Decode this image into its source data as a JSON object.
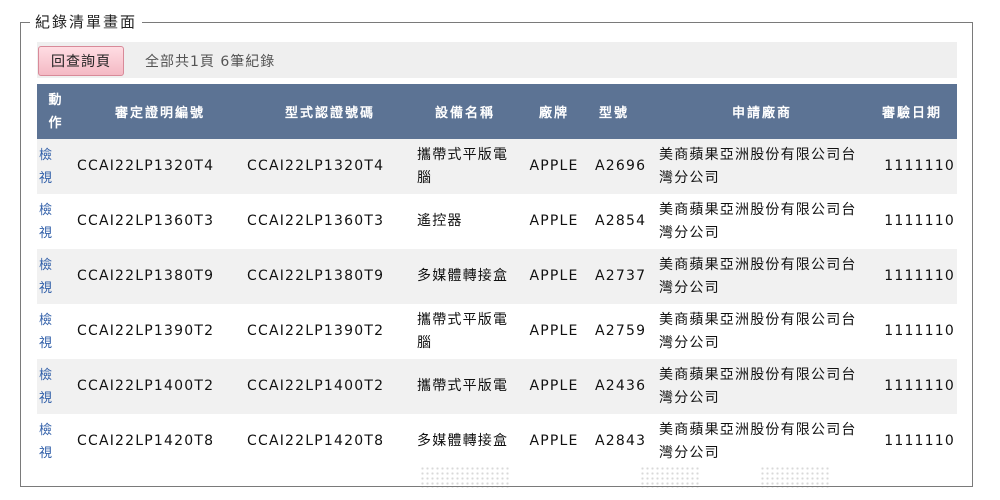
{
  "panel": {
    "title": "紀錄清單畫面"
  },
  "toolbar": {
    "back_label": "回查詢頁",
    "summary": "全部共1頁  6筆紀錄"
  },
  "table": {
    "headers": [
      "動作",
      "審定證明編號",
      "型式認證號碼",
      "設備名稱",
      "廠牌",
      "型號",
      "申請廠商",
      "審驗日期"
    ],
    "rows": [
      {
        "action": "檢視",
        "cert_no": "CCAI22LP1320T4",
        "type_no": "CCAI22LP1320T4",
        "device": "攜帶式平版電腦",
        "brand": "APPLE",
        "model": "A2696",
        "vendor": "美商蘋果亞洲股份有限公司台灣分公司",
        "date": "1111110"
      },
      {
        "action": "檢視",
        "cert_no": "CCAI22LP1360T3",
        "type_no": "CCAI22LP1360T3",
        "device": "遙控器",
        "brand": "APPLE",
        "model": "A2854",
        "vendor": "美商蘋果亞洲股份有限公司台灣分公司",
        "date": "1111110"
      },
      {
        "action": "檢視",
        "cert_no": "CCAI22LP1380T9",
        "type_no": "CCAI22LP1380T9",
        "device": "多媒體轉接盒",
        "brand": "APPLE",
        "model": "A2737",
        "vendor": "美商蘋果亞洲股份有限公司台灣分公司",
        "date": "1111110"
      },
      {
        "action": "檢視",
        "cert_no": "CCAI22LP1390T2",
        "type_no": "CCAI22LP1390T2",
        "device": "攜帶式平版電腦",
        "brand": "APPLE",
        "model": "A2759",
        "vendor": "美商蘋果亞洲股份有限公司台灣分公司",
        "date": "1111110"
      },
      {
        "action": "檢視",
        "cert_no": "CCAI22LP1400T2",
        "type_no": "CCAI22LP1400T2",
        "device": "攜帶式平版電",
        "brand": "APPLE",
        "model": "A2436",
        "vendor": "美商蘋果亞洲股份有限公司台灣分公司",
        "date": "1111110"
      },
      {
        "action": "檢視",
        "cert_no": "CCAI22LP1420T8",
        "type_no": "CCAI22LP1420T8",
        "device": "多媒體轉接盒",
        "brand": "APPLE",
        "model": "A2843",
        "vendor": "美商蘋果亞洲股份有限公司台灣分公司",
        "date": "1111110"
      }
    ]
  },
  "colors": {
    "header_bg": "#5c7394",
    "button_bg": "#f4b9c4",
    "link": "#2f5ea8",
    "row_alt": "#f1f1f1"
  }
}
